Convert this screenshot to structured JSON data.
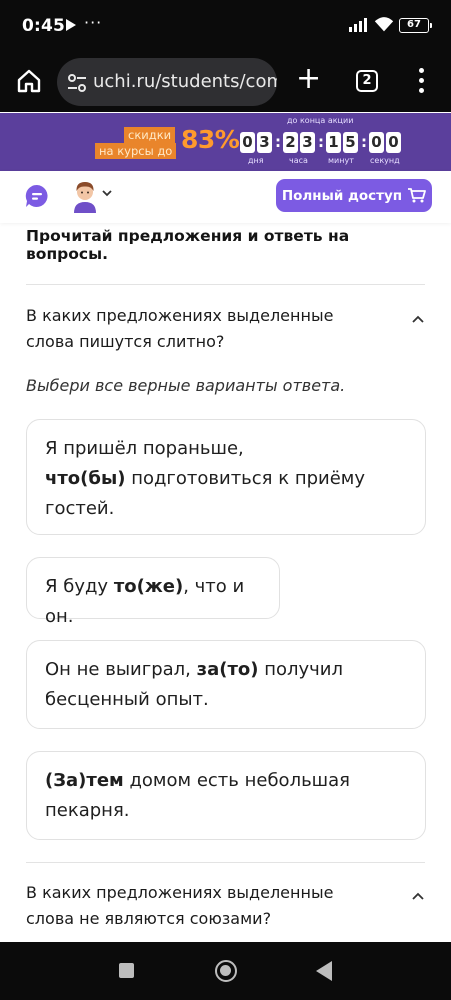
{
  "statusbar": {
    "time": "0:45",
    "more": "···",
    "battery": "67"
  },
  "browser": {
    "url": "uchi.ru/students/com",
    "tab_count": "2"
  },
  "promo": {
    "tag_line1": "скидки",
    "tag_line2": "на курсы до",
    "percent": "83%",
    "until": "до конца акции",
    "digits": [
      "0",
      "3",
      "2",
      "3",
      "1",
      "5",
      "0",
      "0"
    ],
    "labels": [
      "дня",
      "часа",
      "минут",
      "секунд"
    ]
  },
  "header": {
    "access_button": "Полный доступ"
  },
  "colors": {
    "accent": "#7c5be3",
    "promo_bg": "#5b3f9c",
    "promo_orange": "#ff9a2d"
  },
  "content": {
    "instruction": "Прочитай предложения и ответь на вопросы.",
    "question1": "В каких предложениях выделенные слова пишутся слитно?",
    "hint": "Выбери все верные варианты ответа.",
    "options": [
      {
        "before": "Я пришёл пораньше,",
        "bold": "что(бы)",
        "after": " подготовиться к приёму гостей."
      },
      {
        "before": "Я буду ",
        "bold": "то(же)",
        "after": ", что и он."
      },
      {
        "before": "Он не выиграл, ",
        "bold": "за(то)",
        "after": " получил бесценный опыт."
      },
      {
        "before": "",
        "bold": "(За)тем",
        "after": " домом есть небольшая пекарня."
      }
    ],
    "question2": "В каких предложениях выделенные слова не являются союзами?"
  }
}
